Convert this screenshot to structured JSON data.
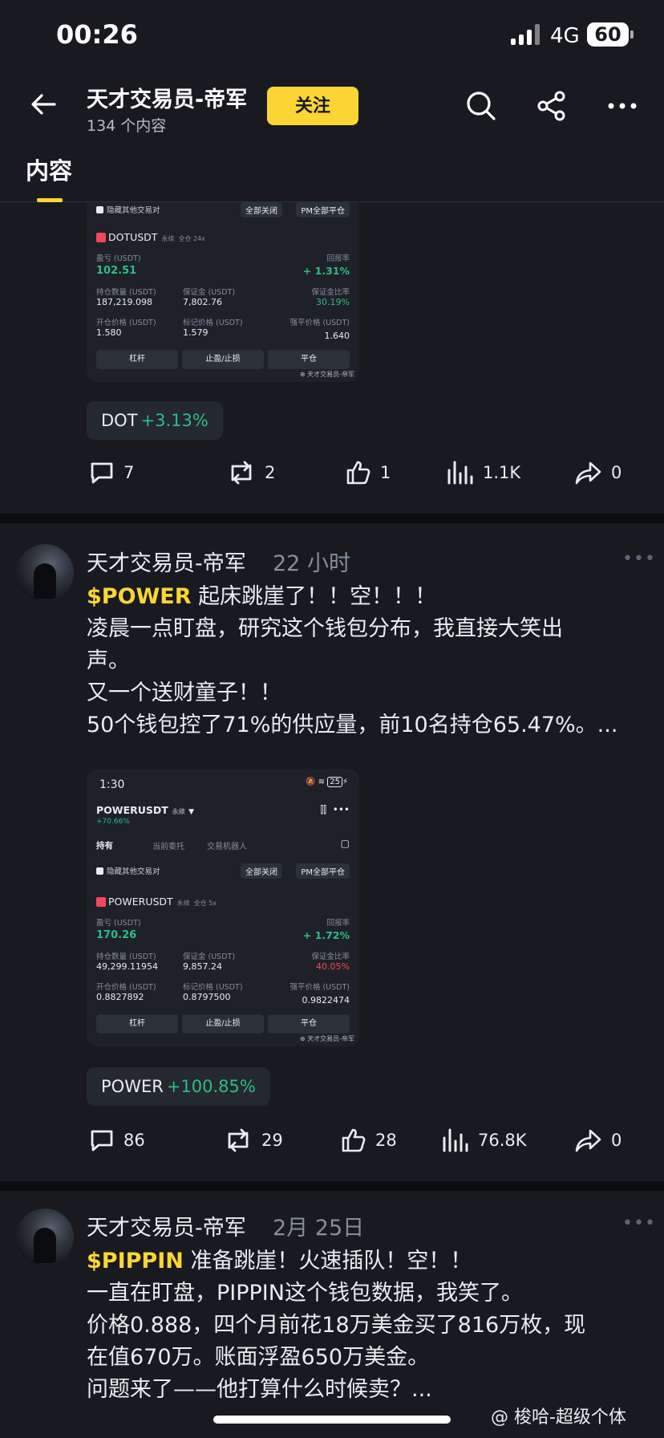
{
  "status_bar": {
    "time": "00:26",
    "network": "4G",
    "battery": "60"
  },
  "header": {
    "title": "天才交易员-帝军",
    "subtitle": "134 个内容",
    "follow_label": "关注"
  },
  "tabs": [
    {
      "label": "内容"
    }
  ],
  "post1": {
    "screenshot": {
      "hide_label": "隐藏其他交易对",
      "close_all": "全部关闭",
      "pm_close": "PM全部平仓",
      "symbol": "DOTUSDT",
      "perp": "永续",
      "margin": "全仓 24x",
      "pnl_label": "盈亏 (USDT)",
      "pnl": "102.51",
      "roi_label": "回报率",
      "roi": "+ 1.31%",
      "size_label": "持仓数量 (USDT)",
      "size": "187,219.098",
      "margin_label": "保证金 (USDT)",
      "margin_val": "7,802.76",
      "ratio_label": "保证金比率",
      "ratio": "30.19%",
      "entry_label": "开仓价格 (USDT)",
      "entry": "1.580",
      "mark_label": "标记价格 (USDT)",
      "mark": "1.579",
      "liq_label": "强平价格 (USDT)",
      "liq": "1.640",
      "btn_leverage": "杠杆",
      "btn_tpsl": "止盈/止损",
      "btn_close": "平仓",
      "watermark": "天才交易员-帝军"
    },
    "ticker": {
      "symbol": "DOT",
      "change": "+3.13%"
    },
    "actions": {
      "comments": "7",
      "reposts": "2",
      "likes": "1",
      "views": "1.1K",
      "shares": "0"
    }
  },
  "post2": {
    "author": "天才交易员-帝军",
    "time": "22 小时",
    "more": "•••",
    "cashtag": "$POWER",
    "lines": [
      "起床跳崖了！！空！！！",
      "凌晨一点盯盘，研究这个钱包分布，我直接大笑出",
      "声。",
      "又一个送财童子！！",
      "50个钱包控了71%的供应量，前10名持仓65.47%。..."
    ],
    "screenshot": {
      "phone_time": "1:30",
      "phone_battery": "25",
      "symbol_header": "POWERUSDT",
      "perp": "永续",
      "header_change": "+70.66%",
      "tab_positions": "持有",
      "tab_orders": "当前委托",
      "tab_bots": "交易机器人",
      "hide_label": "隐藏其他交易对",
      "close_all": "全部关闭",
      "pm_close": "PM全部平仓",
      "symbol": "POWERUSDT",
      "margin": "全仓 5x",
      "pnl_label": "盈亏 (USDT)",
      "pnl": "170.26",
      "roi_label": "回报率",
      "roi": "+ 1.72%",
      "size_label": "持仓数量 (USDT)",
      "size": "49,299.11954",
      "margin_label": "保证金 (USDT)",
      "margin_val": "9,857.24",
      "ratio_label": "保证金比率",
      "ratio": "40.05%",
      "entry_label": "开仓价格 (USDT)",
      "entry": "0.8827892",
      "mark_label": "标记价格 (USDT)",
      "mark": "0.8797500",
      "liq_label": "强平价格 (USDT)",
      "liq": "0.9822474",
      "btn_leverage": "杠杆",
      "btn_tpsl": "止盈/止损",
      "btn_close": "平仓",
      "watermark": "天才交易员-帝军"
    },
    "ticker": {
      "symbol": "POWER",
      "change": "+100.85%"
    },
    "actions": {
      "comments": "86",
      "reposts": "29",
      "likes": "28",
      "views": "76.8K",
      "shares": "0"
    }
  },
  "post3": {
    "author": "天才交易员-帝军",
    "time": "2月 25日",
    "more": "•••",
    "cashtag": "$PIPPIN",
    "lines": [
      "准备跳崖！火速插队！空！！",
      "一直在盯盘，PIPPIN这个钱包数据，我笑了。",
      "价格0.888，四个月前花18万美金买了816万枚，现",
      "在值670万。账面浮盈650万美金。",
      "问题来了——他打算什么时候卖？..."
    ]
  },
  "watermark": "@ 梭哈-超级个体",
  "colors": {
    "accent": "#fcd535",
    "up": "#2ebd85",
    "down": "#f6465d",
    "bg": "#181a20"
  }
}
